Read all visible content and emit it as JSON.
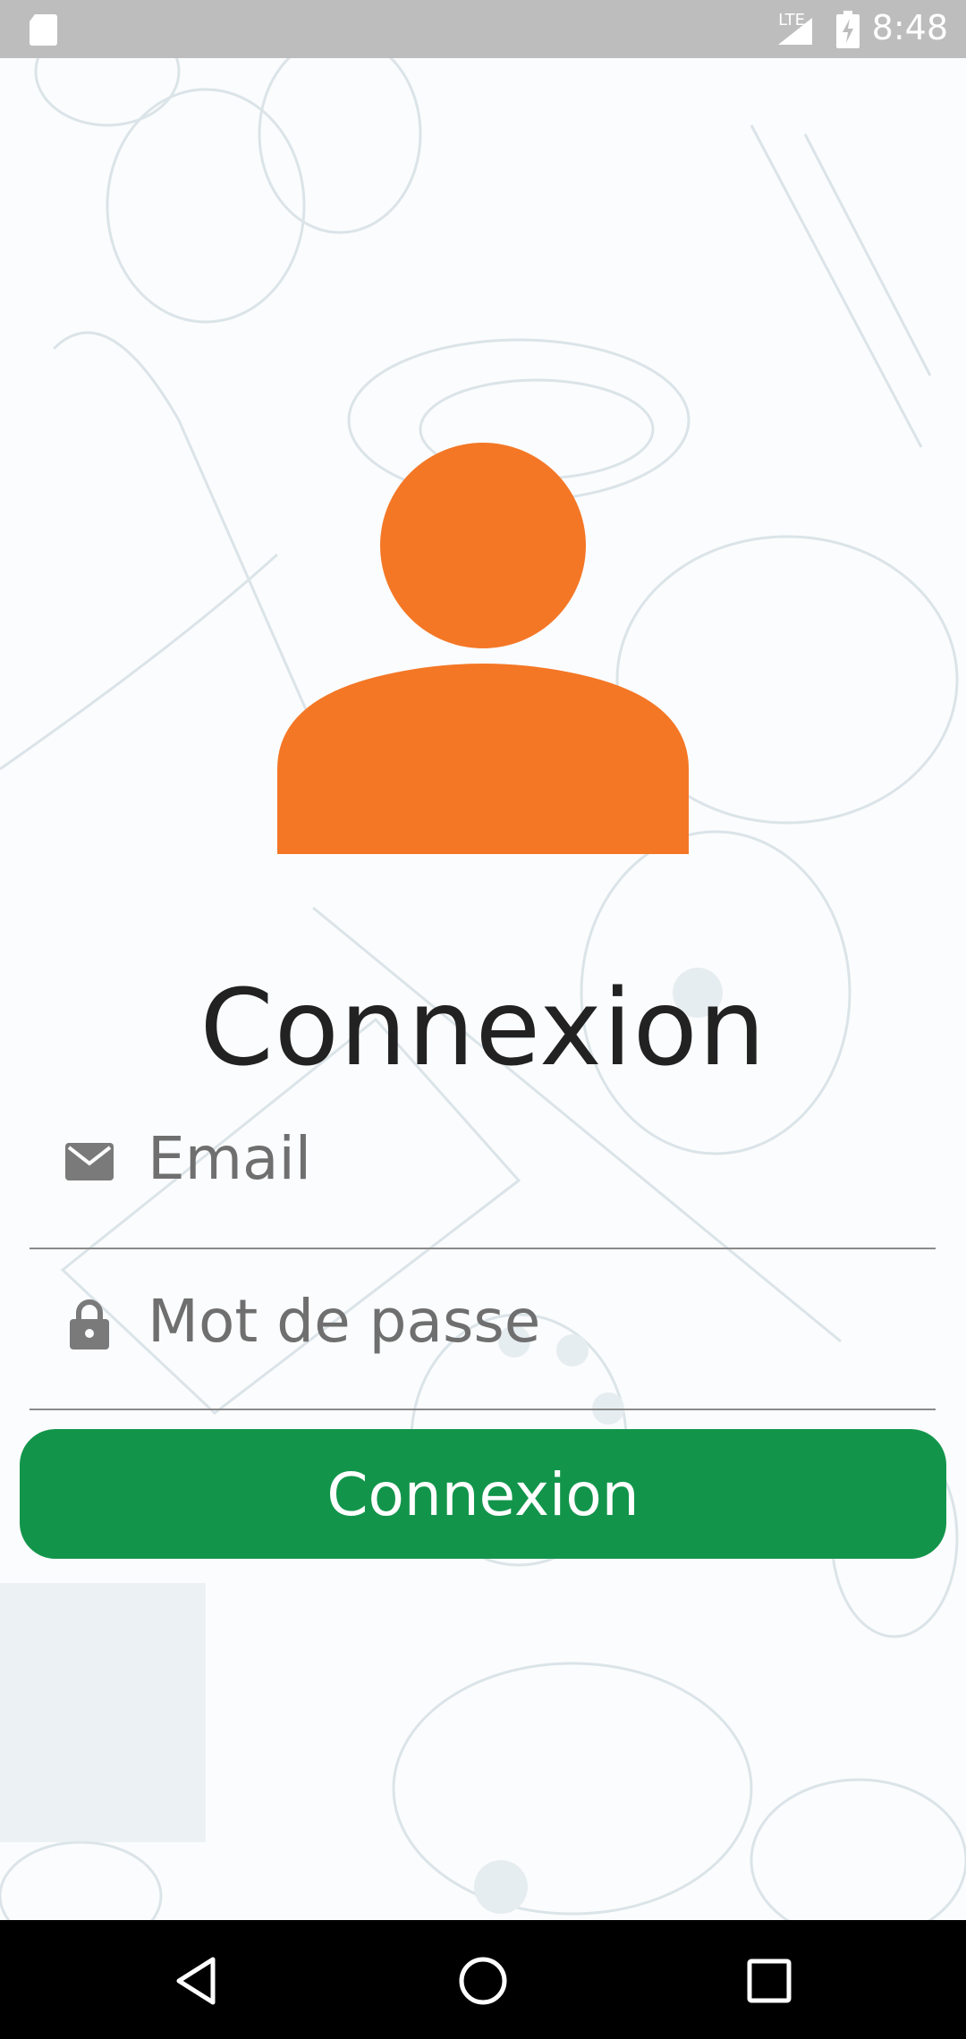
{
  "status_bar": {
    "network": "LTE",
    "time": "8:48",
    "icons": [
      "sd-card-icon",
      "signal-icon",
      "battery-charging-icon"
    ]
  },
  "login": {
    "avatar_icon": "user-avatar-icon",
    "title": "Connexion",
    "email_placeholder": "Email",
    "password_placeholder": "Mot de passe",
    "submit_label": "Connexion"
  },
  "colors": {
    "accent": "#f47726",
    "button": "#12954b",
    "status_bar": "#bdbdbd",
    "nav_bar": "#000000"
  },
  "nav_bar": {
    "icons": [
      "back-icon",
      "home-icon",
      "recents-icon"
    ]
  }
}
